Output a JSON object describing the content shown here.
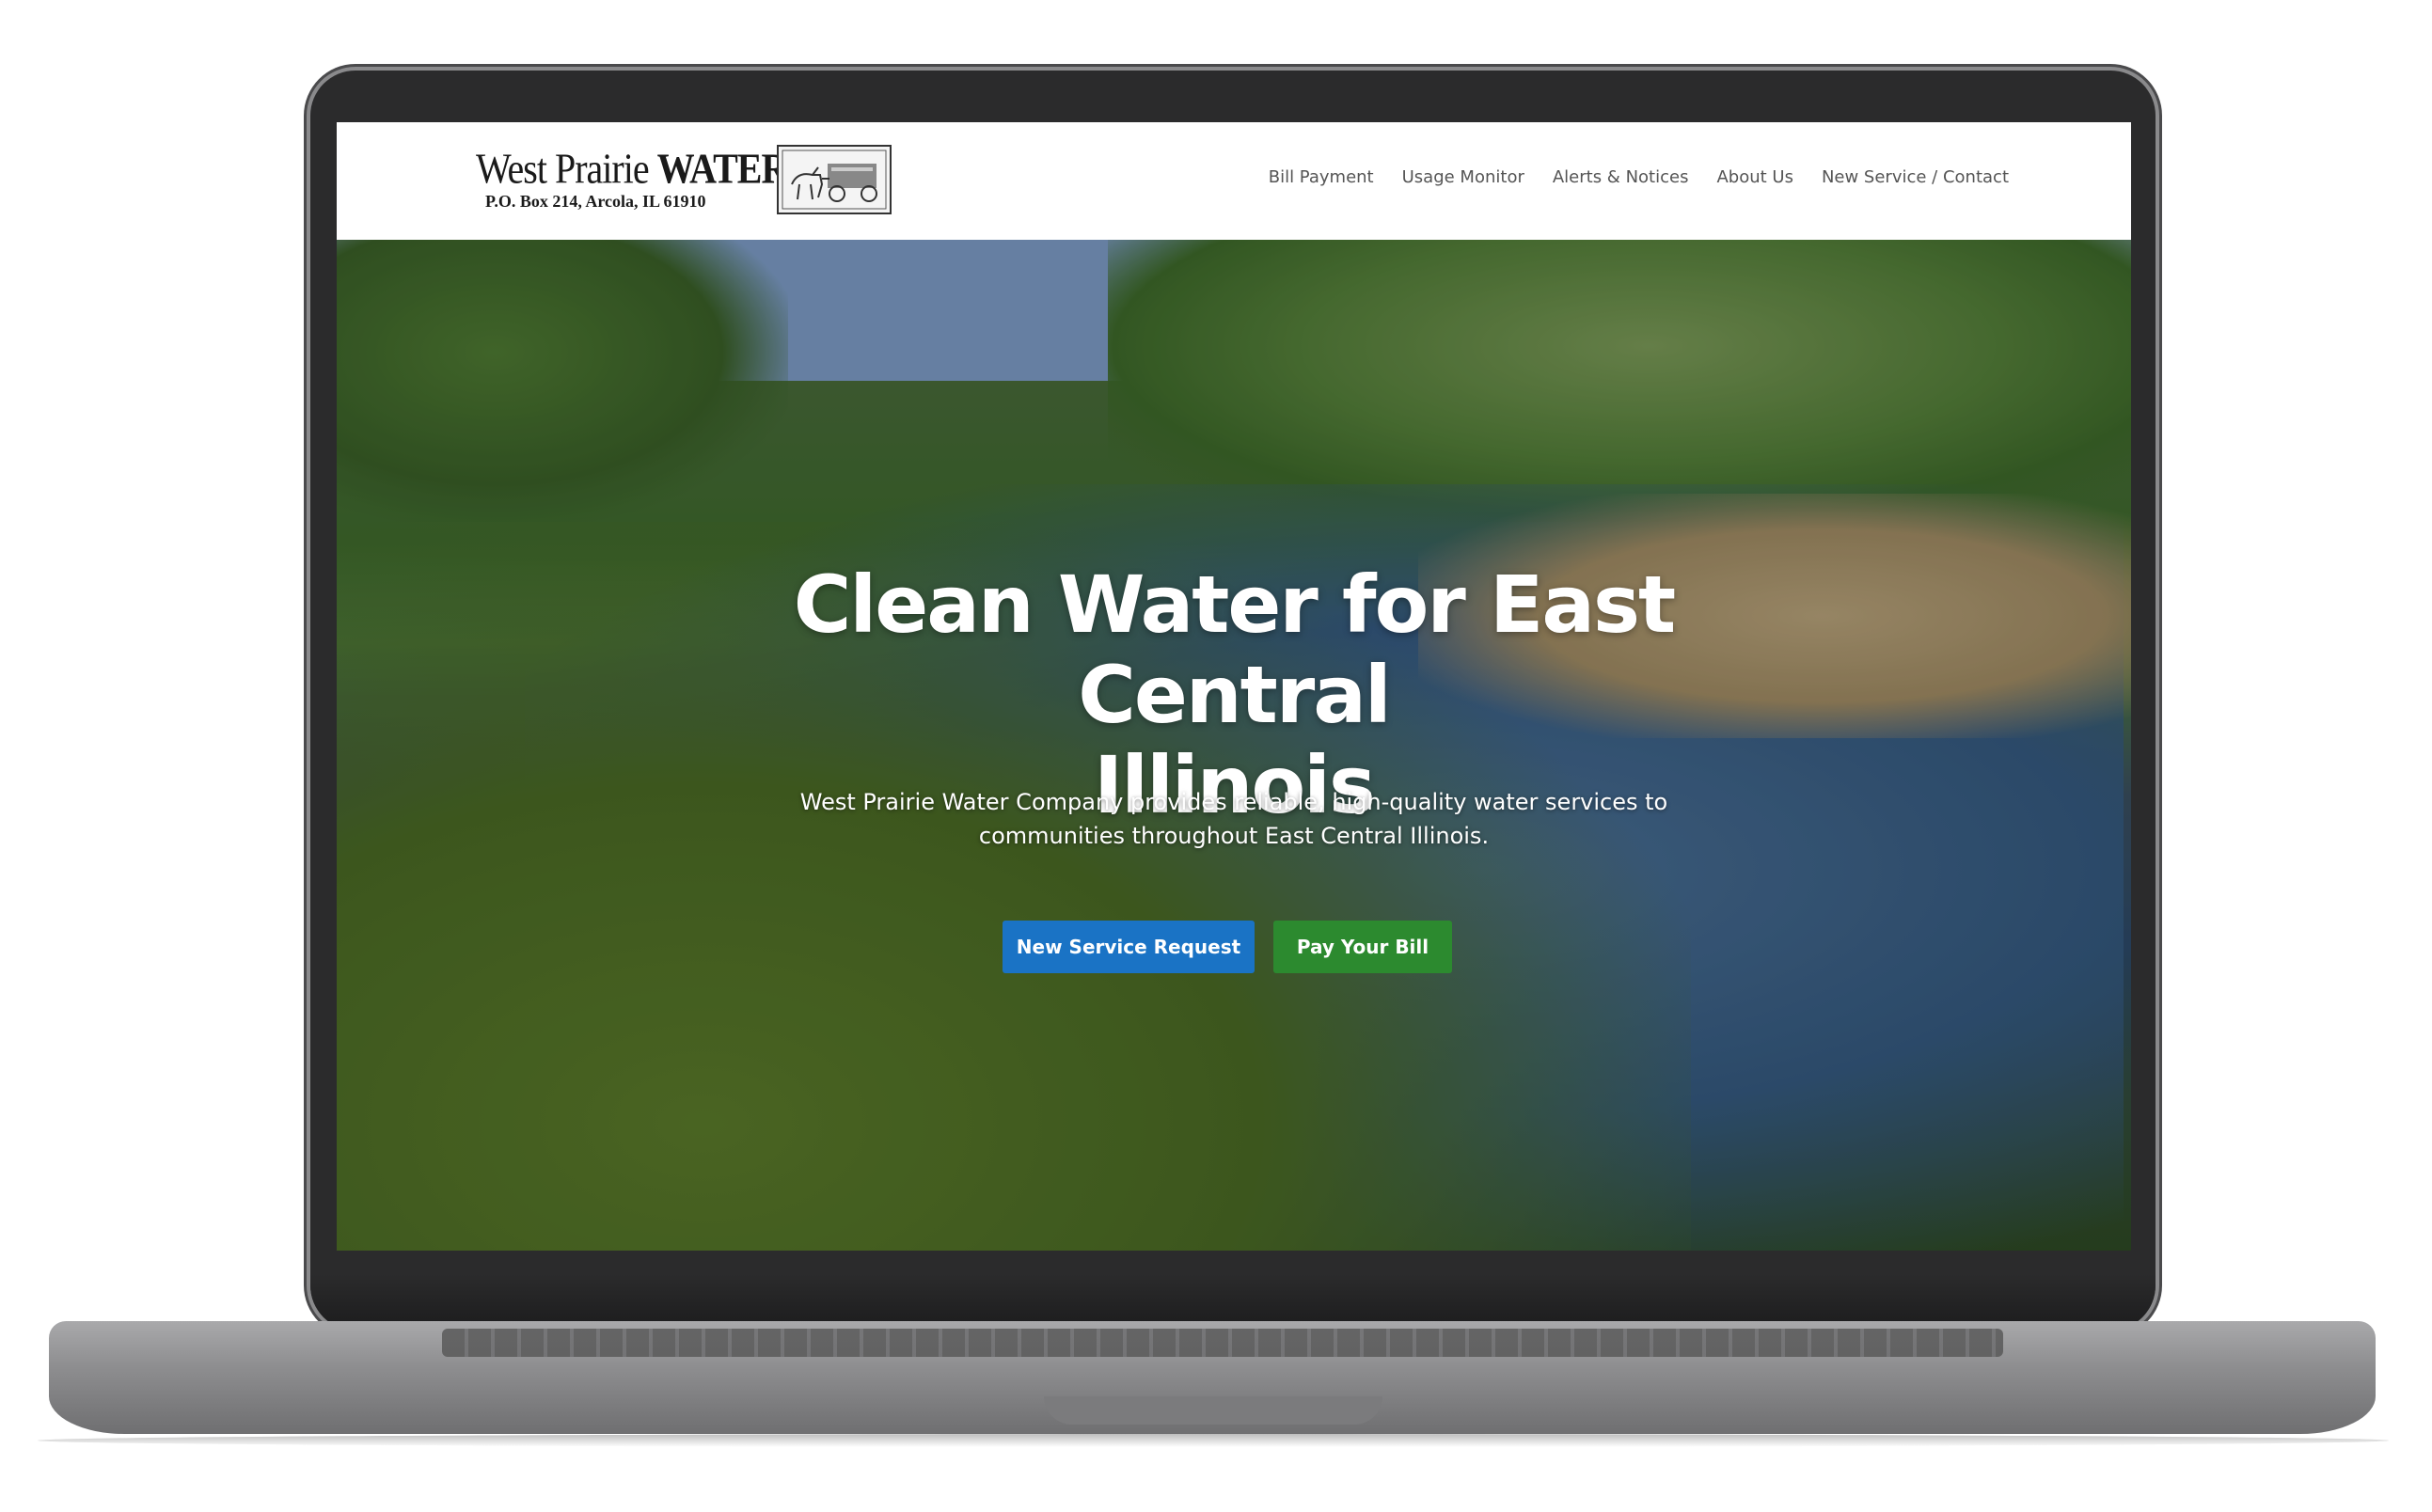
{
  "logo": {
    "name_light": "West Prairie",
    "name_bold": "WATER Cº",
    "address": "P.O. Box 214, Arcola, IL 61910"
  },
  "nav": [
    {
      "label": "Bill Payment"
    },
    {
      "label": "Usage Monitor"
    },
    {
      "label": "Alerts & Notices"
    },
    {
      "label": "About Us"
    },
    {
      "label": "New Service / Contact"
    }
  ],
  "hero": {
    "title_line1": "Clean Water for East Central",
    "title_line2": "Illinois",
    "subtitle": "West Prairie Water Company provides reliable, high-quality water services to communities throughout East Central Illinois.",
    "buttons": {
      "new_service": "New Service Request",
      "pay_bill": "Pay Your Bill"
    }
  },
  "colors": {
    "primary_button": "#1a73c5",
    "secondary_button": "#2c8a2f"
  }
}
